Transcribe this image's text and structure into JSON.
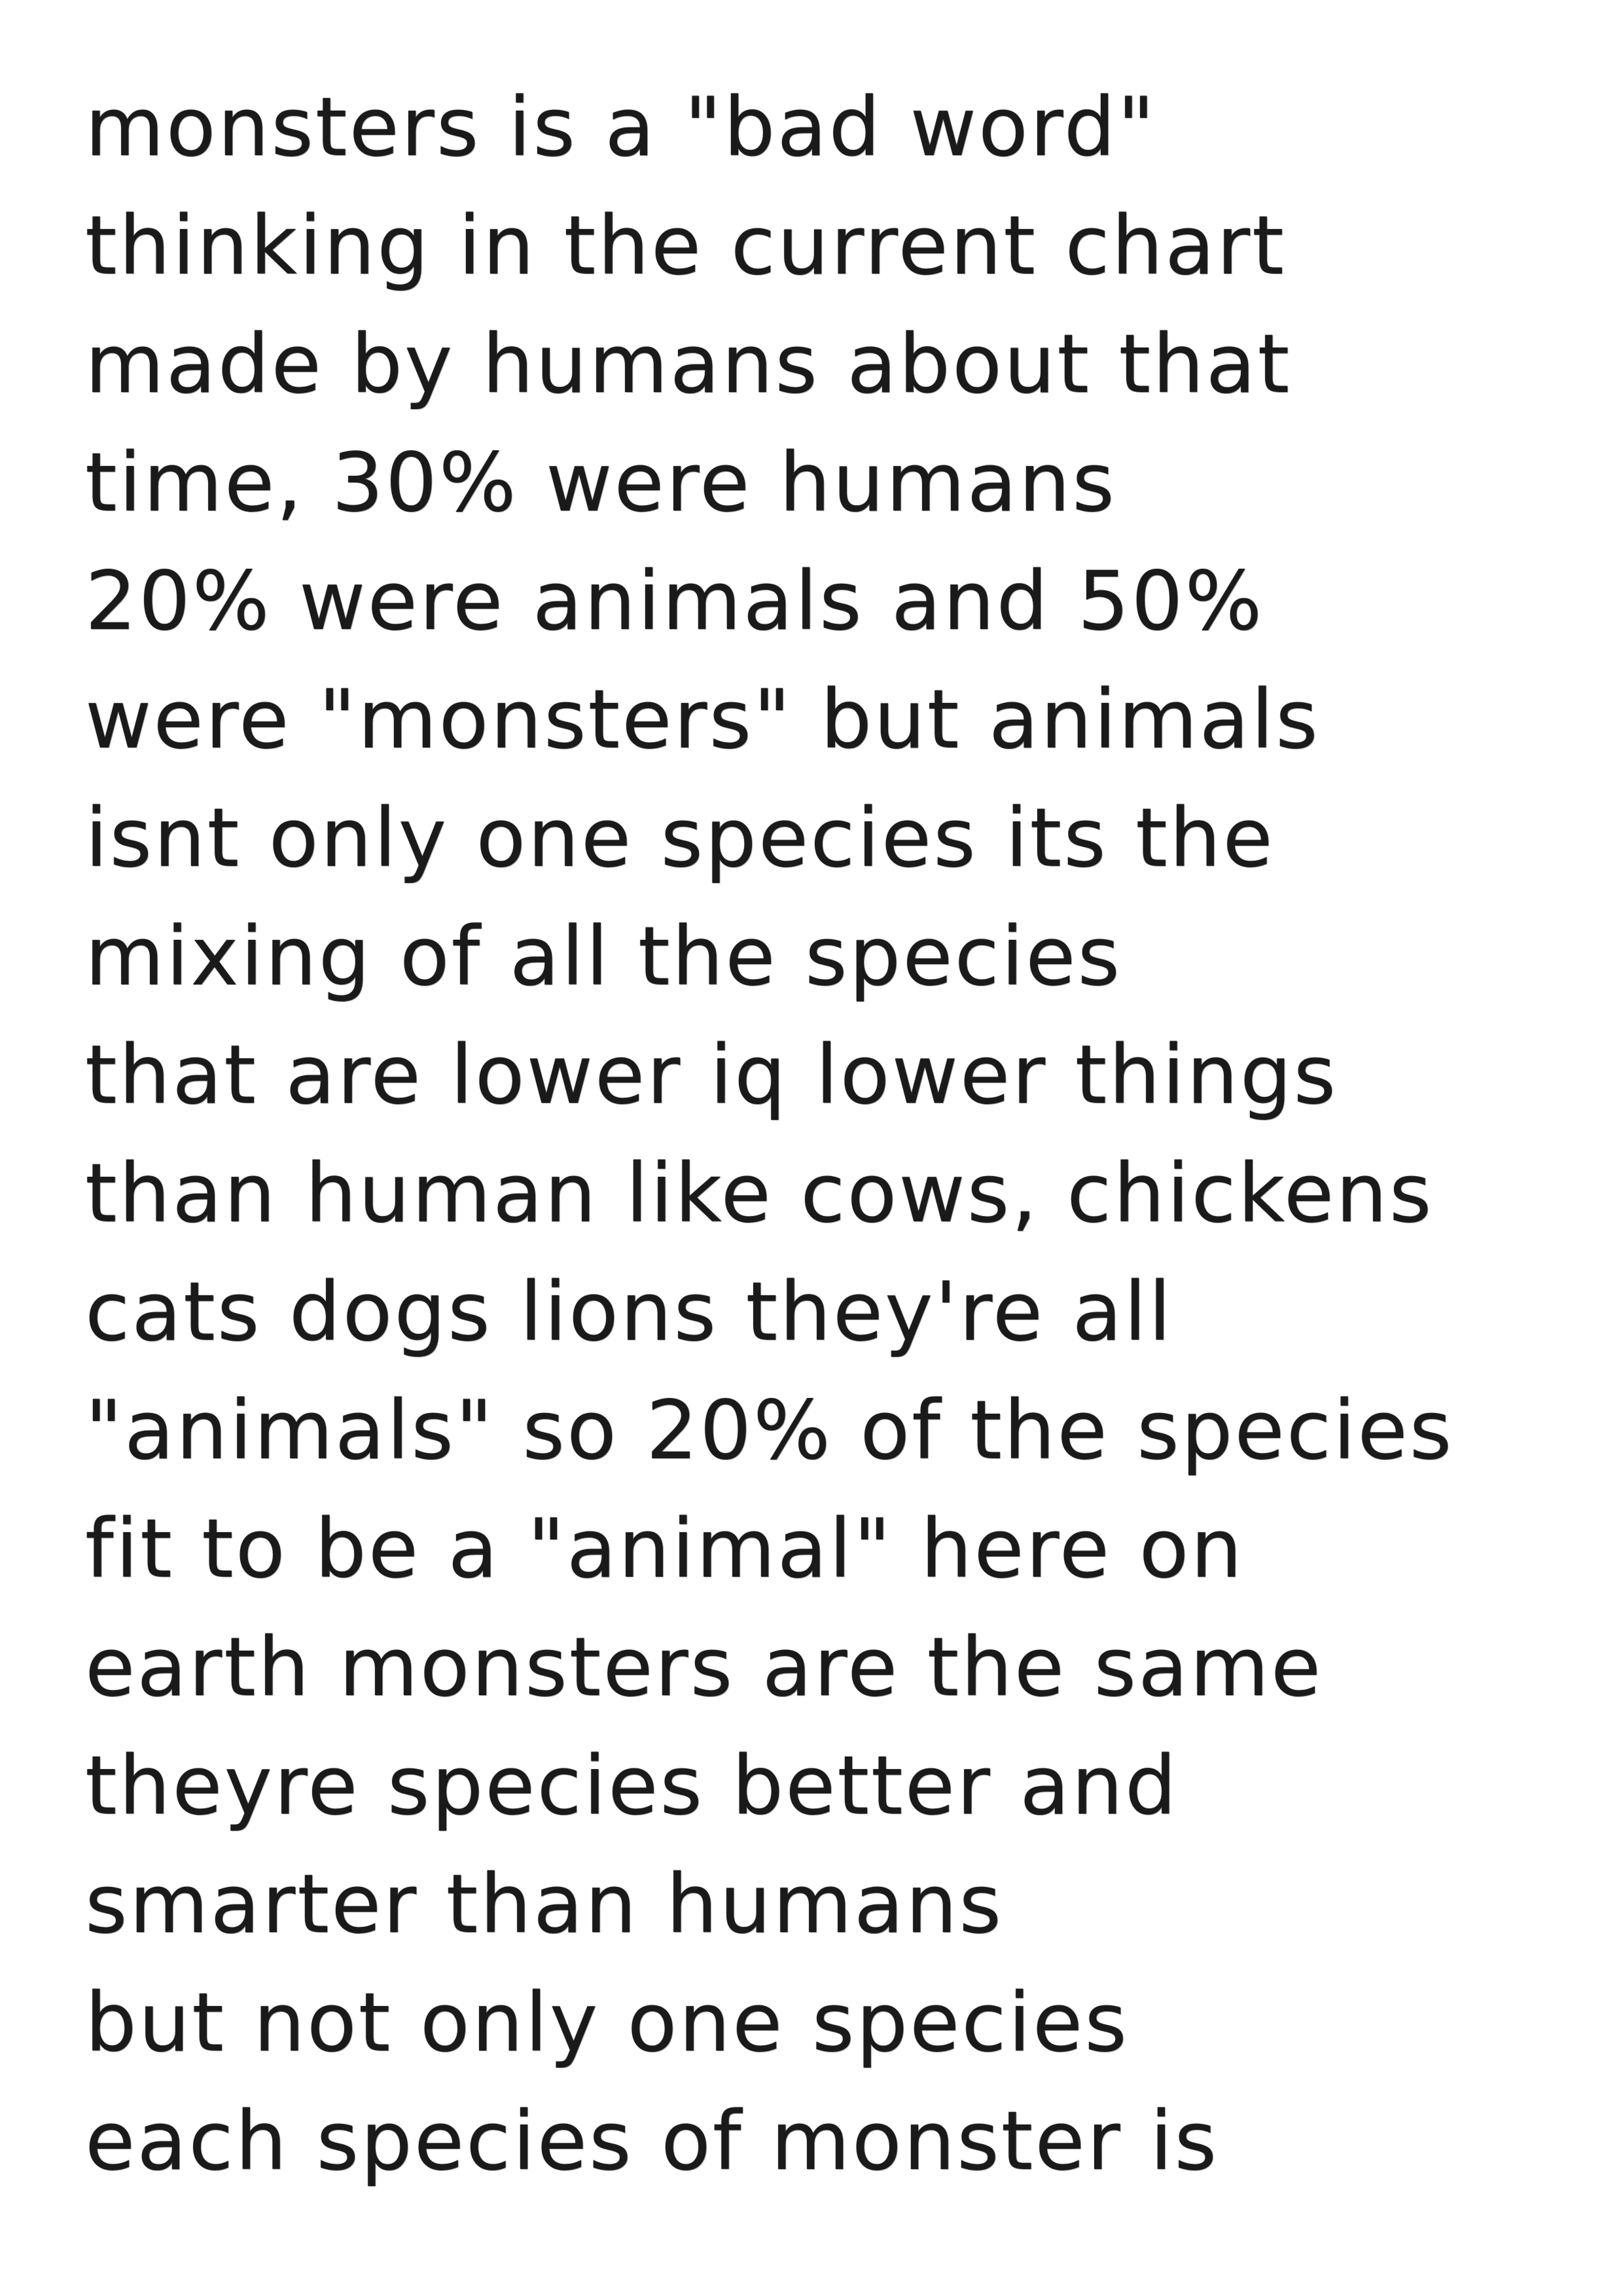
{
  "handwritten_note": {
    "lines": [
      "monsters is a \"bad word\"",
      "thinking in the current chart",
      "made by humans about that",
      "time, 30% were humans",
      "20% were animals and 50%",
      "were \"monsters\" but animals",
      "isnt only one species its the",
      "mixing of all the species",
      "that are lower iq lower things",
      "than human like cows, chickens",
      "cats dogs lions they're all",
      "\"animals\" so 20% of the species",
      "fit to be a \"animal\" here on",
      "earth monsters are the same",
      "theyre species better and",
      "smarter than humans",
      "but not only one species",
      "each species of monster is"
    ]
  }
}
